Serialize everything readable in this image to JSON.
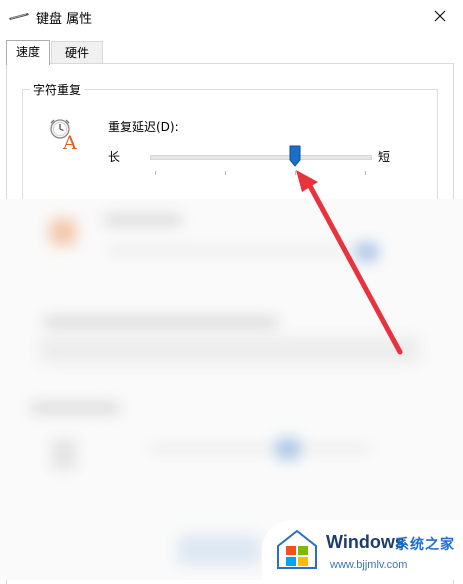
{
  "window": {
    "title": "键盘 属性"
  },
  "tabs": [
    {
      "label": "速度",
      "active": true
    },
    {
      "label": "硬件",
      "active": false
    }
  ],
  "char_repeat": {
    "group_title": "字符重复",
    "repeat_delay": {
      "label": "重复延迟(D):",
      "min_label": "长",
      "max_label": "短",
      "tick_count": 4,
      "value_position": 3,
      "value_fraction": 0.66
    }
  },
  "annotation": {
    "arrow_color": "#e8323c"
  },
  "watermark": {
    "brand": "Windows",
    "site_name": "系统之家",
    "url": "www.bjjmlv.com",
    "colors": {
      "brand": "#1d3d6e",
      "site": "#1f6fd1"
    }
  },
  "colors": {
    "slider_thumb": "#1a6fc9",
    "accent": "#0078d7"
  }
}
